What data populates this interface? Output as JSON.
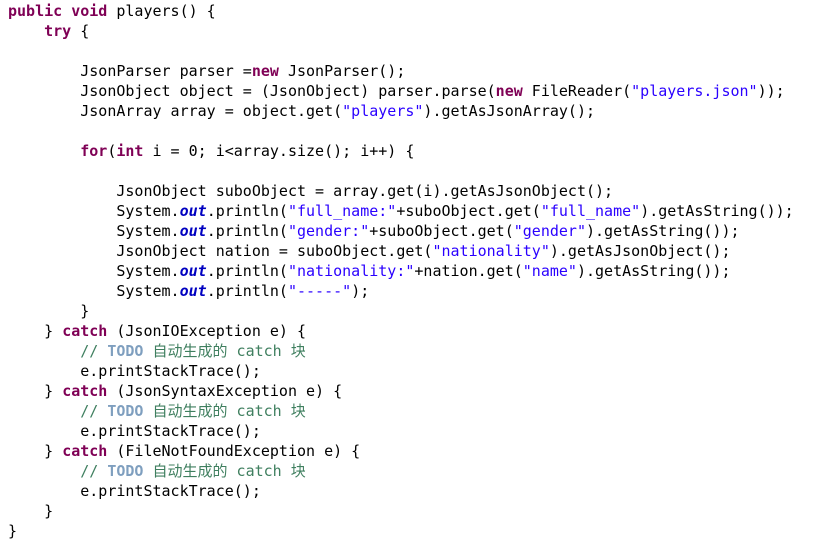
{
  "code": {
    "language": "java",
    "lines": [
      [
        {
          "t": "public",
          "c": "kw"
        },
        {
          "t": " "
        },
        {
          "t": "void",
          "c": "kw"
        },
        {
          "t": " players() {"
        }
      ],
      [
        {
          "t": "    "
        },
        {
          "t": "try",
          "c": "kw"
        },
        {
          "t": " {"
        }
      ],
      [],
      [
        {
          "t": "        JsonParser parser ="
        },
        {
          "t": "new",
          "c": "kw"
        },
        {
          "t": " JsonParser();"
        }
      ],
      [
        {
          "t": "        JsonObject object = (JsonObject) parser.parse("
        },
        {
          "t": "new",
          "c": "kw"
        },
        {
          "t": " FileReader("
        },
        {
          "t": "\"players.json\"",
          "c": "str"
        },
        {
          "t": "));"
        }
      ],
      [
        {
          "t": "        JsonArray array = object.get("
        },
        {
          "t": "\"players\"",
          "c": "str"
        },
        {
          "t": ").getAsJsonArray();"
        }
      ],
      [],
      [
        {
          "t": "        "
        },
        {
          "t": "for",
          "c": "kw"
        },
        {
          "t": "("
        },
        {
          "t": "int",
          "c": "kw"
        },
        {
          "t": " i = 0; i<array.size(); i++) {"
        }
      ],
      [],
      [
        {
          "t": "            JsonObject suboObject = array.get(i).getAsJsonObject();"
        }
      ],
      [
        {
          "t": "            System."
        },
        {
          "t": "out",
          "c": "field"
        },
        {
          "t": ".println("
        },
        {
          "t": "\"full_name:\"",
          "c": "str"
        },
        {
          "t": "+suboObject.get("
        },
        {
          "t": "\"full_name\"",
          "c": "str"
        },
        {
          "t": ").getAsString());"
        }
      ],
      [
        {
          "t": "            System."
        },
        {
          "t": "out",
          "c": "field"
        },
        {
          "t": ".println("
        },
        {
          "t": "\"gender:\"",
          "c": "str"
        },
        {
          "t": "+suboObject.get("
        },
        {
          "t": "\"gender\"",
          "c": "str"
        },
        {
          "t": ").getAsString());"
        }
      ],
      [
        {
          "t": "            JsonObject nation = suboObject.get("
        },
        {
          "t": "\"nationality\"",
          "c": "str"
        },
        {
          "t": ").getAsJsonObject();"
        }
      ],
      [
        {
          "t": "            System."
        },
        {
          "t": "out",
          "c": "field"
        },
        {
          "t": ".println("
        },
        {
          "t": "\"nationality:\"",
          "c": "str"
        },
        {
          "t": "+nation.get("
        },
        {
          "t": "\"name\"",
          "c": "str"
        },
        {
          "t": ").getAsString());"
        }
      ],
      [
        {
          "t": "            System."
        },
        {
          "t": "out",
          "c": "field"
        },
        {
          "t": ".println("
        },
        {
          "t": "\"-----\"",
          "c": "str"
        },
        {
          "t": ");"
        }
      ],
      [
        {
          "t": "        }"
        }
      ],
      [
        {
          "t": "    } "
        },
        {
          "t": "catch",
          "c": "kw"
        },
        {
          "t": " (JsonIOException e) {"
        }
      ],
      [
        {
          "t": "        "
        },
        {
          "t": "// ",
          "c": "comment"
        },
        {
          "t": "TODO",
          "c": "todo"
        },
        {
          "t": " ",
          "c": "comment"
        },
        {
          "t": "自动生成的",
          "c": "comment cjk"
        },
        {
          "t": " catch ",
          "c": "comment"
        },
        {
          "t": "块",
          "c": "comment cjk"
        }
      ],
      [
        {
          "t": "        e.printStackTrace();"
        }
      ],
      [
        {
          "t": "    } "
        },
        {
          "t": "catch",
          "c": "kw"
        },
        {
          "t": " (JsonSyntaxException e) {"
        }
      ],
      [
        {
          "t": "        "
        },
        {
          "t": "// ",
          "c": "comment"
        },
        {
          "t": "TODO",
          "c": "todo"
        },
        {
          "t": " ",
          "c": "comment"
        },
        {
          "t": "自动生成的",
          "c": "comment cjk"
        },
        {
          "t": " catch ",
          "c": "comment"
        },
        {
          "t": "块",
          "c": "comment cjk"
        }
      ],
      [
        {
          "t": "        e.printStackTrace();"
        }
      ],
      [
        {
          "t": "    } "
        },
        {
          "t": "catch",
          "c": "kw"
        },
        {
          "t": " (FileNotFoundException e) {"
        }
      ],
      [
        {
          "t": "        "
        },
        {
          "t": "// ",
          "c": "comment"
        },
        {
          "t": "TODO",
          "c": "todo"
        },
        {
          "t": " ",
          "c": "comment"
        },
        {
          "t": "自动生成的",
          "c": "comment cjk"
        },
        {
          "t": " catch ",
          "c": "comment"
        },
        {
          "t": "块",
          "c": "comment cjk"
        }
      ],
      [
        {
          "t": "        e.printStackTrace();"
        }
      ],
      [
        {
          "t": "    }"
        }
      ],
      [
        {
          "t": "}"
        }
      ]
    ]
  },
  "colors": {
    "background": "#ffffff",
    "plain": "#000000",
    "keyword": "#7f0055",
    "string": "#2a00ff",
    "static_field": "#0000c0",
    "comment": "#3f7f5f",
    "todo_tag": "#7f9fbf"
  }
}
